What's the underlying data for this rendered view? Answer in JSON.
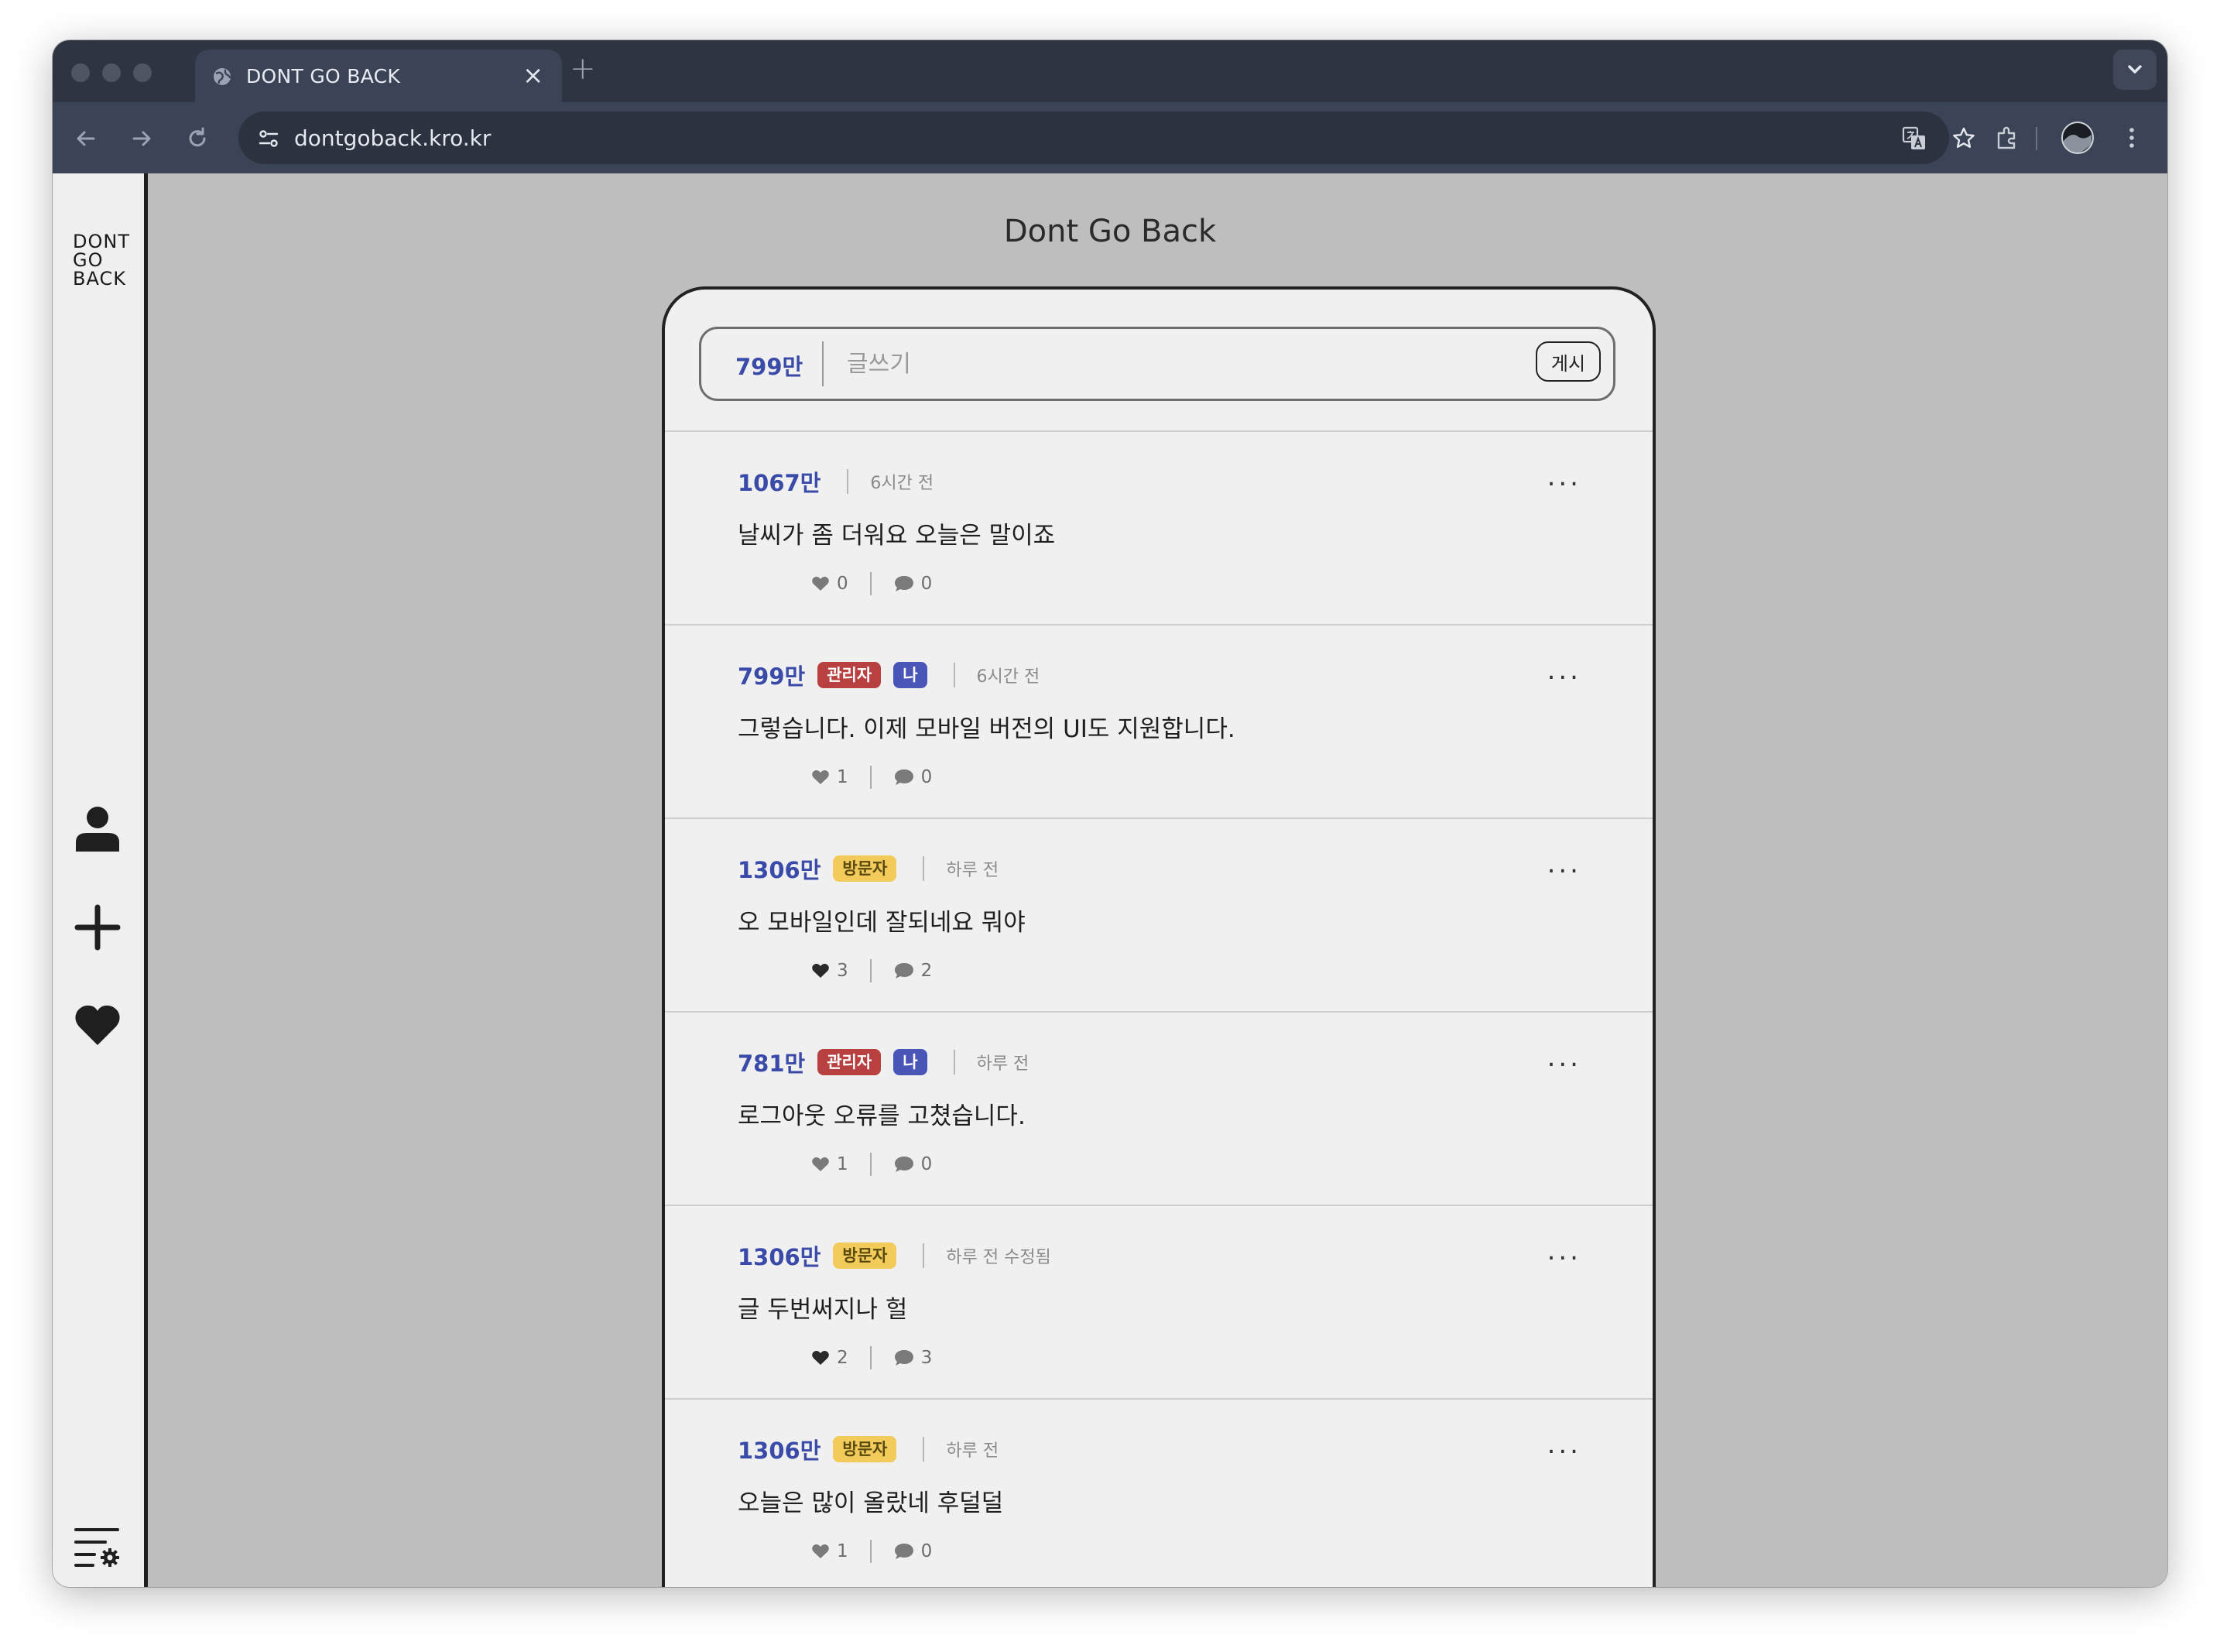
{
  "browser": {
    "tab_title": "DONT GO BACK",
    "tab_close": "×",
    "new_tab": "+",
    "url": "dontgoback.kro.kr"
  },
  "sidebar": {
    "logo_lines": [
      "DONT",
      "GO",
      "BACK"
    ],
    "icons": [
      "person-icon",
      "plus-icon",
      "heart-icon",
      "settings-list-icon"
    ]
  },
  "page": {
    "title": "Dont Go Back"
  },
  "compose": {
    "user": "799만",
    "placeholder": "글쓰기",
    "submit_label": "게시"
  },
  "posts": [
    {
      "author": "1067만",
      "badges": [],
      "time": "6시간 전",
      "content": "날씨가 좀 더워요 오늘은 말이죠",
      "likes": "0",
      "comments": "0",
      "liked": false
    },
    {
      "author": "799만",
      "badges": [
        {
          "label": "관리자",
          "type": "admin"
        },
        {
          "label": "나",
          "type": "me"
        }
      ],
      "time": "6시간 전",
      "content": "그렇습니다. 이제 모바일 버전의 UI도 지원합니다.",
      "likes": "1",
      "comments": "0",
      "liked": false
    },
    {
      "author": "1306만",
      "badges": [
        {
          "label": "방문자",
          "type": "visitor"
        }
      ],
      "time": "하루 전",
      "content": "오 모바일인데 잘되네요 뭐야",
      "likes": "3",
      "comments": "2",
      "liked": true
    },
    {
      "author": "781만",
      "badges": [
        {
          "label": "관리자",
          "type": "admin"
        },
        {
          "label": "나",
          "type": "me"
        }
      ],
      "time": "하루 전",
      "content": "로그아웃 오류를 고쳤습니다.",
      "likes": "1",
      "comments": "0",
      "liked": false
    },
    {
      "author": "1306만",
      "badges": [
        {
          "label": "방문자",
          "type": "visitor"
        }
      ],
      "time": "하루 전 수정됨",
      "content": "글 두번써지나 헐",
      "likes": "2",
      "comments": "3",
      "liked": true
    },
    {
      "author": "1306만",
      "badges": [
        {
          "label": "방문자",
          "type": "visitor"
        }
      ],
      "time": "하루 전",
      "content": "오늘은 많이 올랐네 후덜덜",
      "likes": "1",
      "comments": "0",
      "liked": false
    }
  ],
  "more_label": "...",
  "colors": {
    "accent": "#3a4aa8",
    "admin_badge": "#b84040",
    "me_badge": "#4a55b8",
    "visitor_badge": "#f2cb5b",
    "page_bg": "#bebebe",
    "chrome_bg": "#2e3441"
  }
}
